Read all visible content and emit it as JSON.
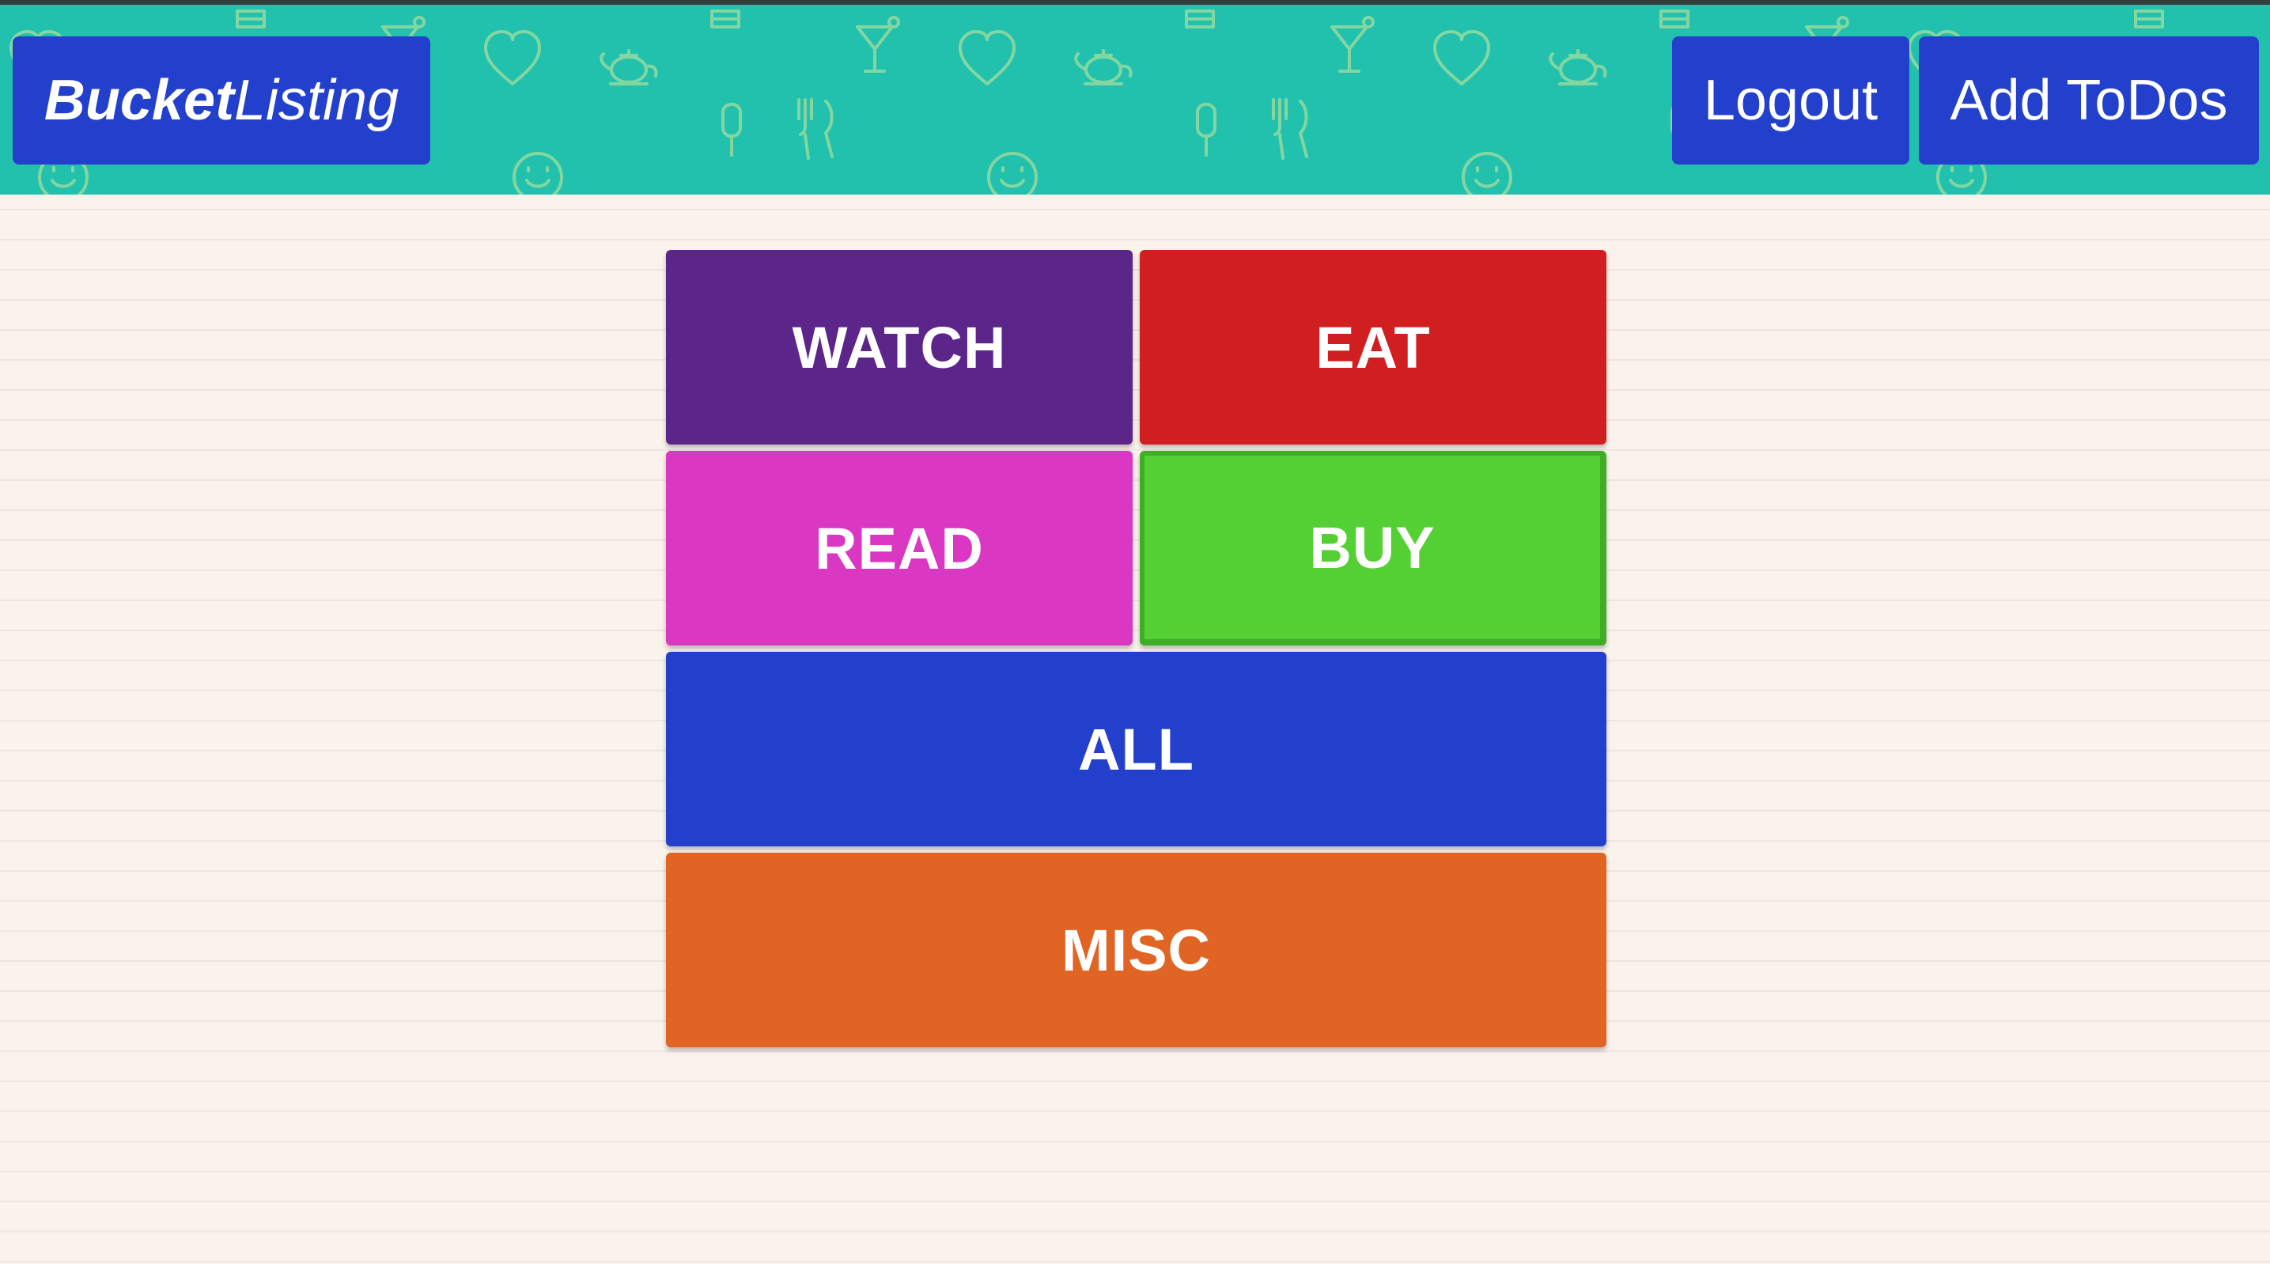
{
  "header": {
    "brand_bold": "Bucket",
    "brand_light": "Listing",
    "logout_label": "Logout",
    "add_todos_label": "Add ToDos"
  },
  "categories": [
    {
      "label": "WATCH",
      "color": "#5c2589"
    },
    {
      "label": "EAT",
      "color": "#d11f21"
    },
    {
      "label": "READ",
      "color": "#da37c2"
    },
    {
      "label": "BUY",
      "color": "#54d035"
    },
    {
      "label": "ALL",
      "color": "#2340cc"
    },
    {
      "label": "MISC",
      "color": "#e06524"
    }
  ],
  "colors": {
    "navbar": "#22c1ad",
    "page_background": "#faf3ec",
    "nav_button": "#2340cc"
  },
  "pattern_icons": [
    "heart-icon",
    "teapot-icon",
    "cocktail-icon",
    "popsicle-icon",
    "utensils-icon",
    "smiley-icon",
    "cake-icon"
  ]
}
